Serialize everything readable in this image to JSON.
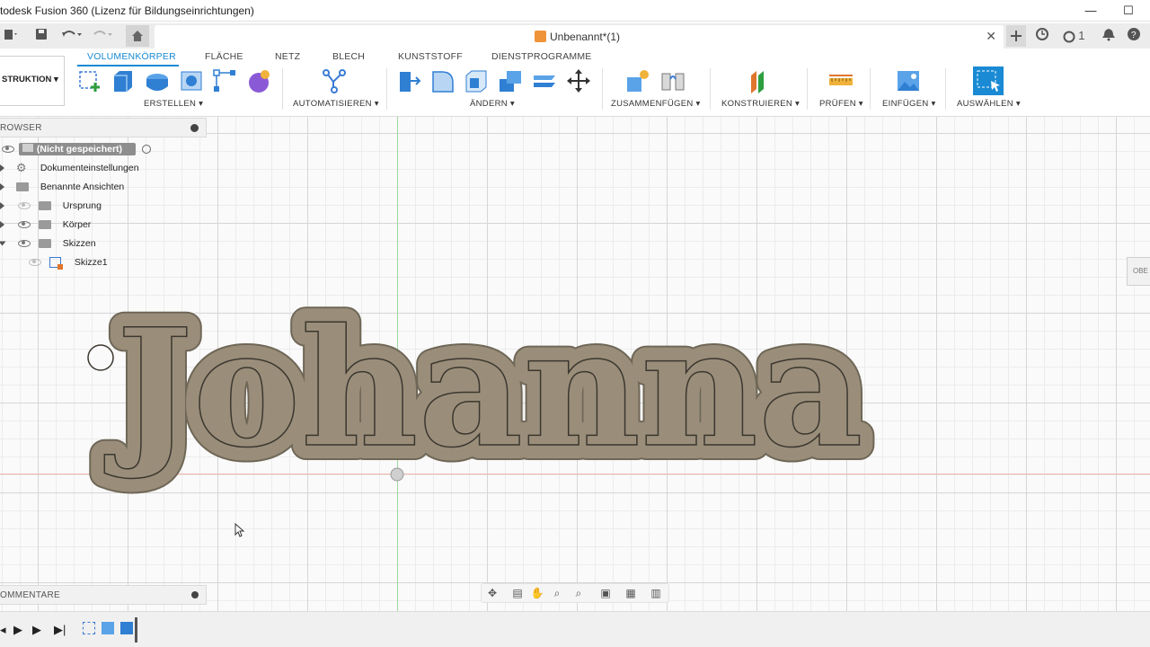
{
  "window": {
    "title": "todesk Fusion 360 (Lizenz für Bildungseinrichtungen)",
    "minimize_glyph": "—",
    "maximize_glyph": "☐"
  },
  "quick_access": {
    "document_tab_label": "Unbenannt*(1)",
    "notification_count": "1"
  },
  "ribbon": {
    "tabs": [
      "VOLUMENKÖRPER",
      "FLÄCHE",
      "NETZ",
      "BLECH",
      "KUNSTSTOFF",
      "DIENSTPROGRAMME"
    ],
    "workspace_label": "STRUKTION",
    "groups": [
      "ERSTELLEN",
      "AUTOMATISIEREN",
      "ÄNDERN",
      "ZUSAMMENFÜGEN",
      "KONSTRUIEREN",
      "PRÜFEN",
      "EINFÜGEN",
      "AUSWÄHLEN"
    ]
  },
  "browser": {
    "header": "ROWSER",
    "root": "(Nicht gespeichert)",
    "items": [
      "Dokumenteinstellungen",
      "Benannte Ansichten",
      "Ursprung",
      "Körper",
      "Skizzen",
      "Skizze1"
    ]
  },
  "comments": {
    "header": "OMMENTARE"
  },
  "viewcube": {
    "label": "OBE"
  },
  "sketch": {
    "text": "Johanna"
  },
  "colors": {
    "accent": "#1a8ad4",
    "body_fill": "#9a8e7a",
    "axis_green": "#9fd89a",
    "axis_red": "#f3b3a8"
  }
}
